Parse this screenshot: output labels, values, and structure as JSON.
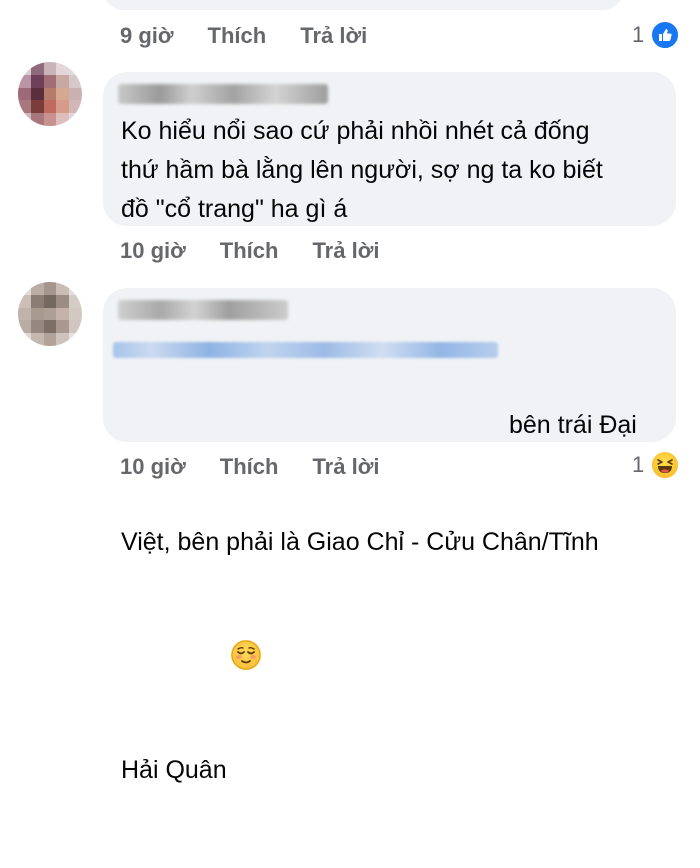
{
  "top_comment": {
    "time": "9 giờ",
    "like_label": "Thích",
    "reply_label": "Trả lời",
    "reaction_count": "1",
    "reaction_icon": "like-icon",
    "accent": "#1877f2"
  },
  "comments": [
    {
      "author": "",
      "text": "Ko hiểu nổi sao cứ phải nhồi nhét cả đống\nthứ hầm bà lằng lên người, sợ ng ta ko biết\nđồ \"cổ trang\" ha gì á",
      "time": "10 giờ",
      "like_label": "Thích",
      "reply_label": "Trả lời"
    },
    {
      "author": "",
      "text_line1_suffix": "bên trái Đại",
      "text_line2": "Việt, bên phải là Giao Chỉ - Cửu Chân/Tĩnh",
      "text_line3": "Hải Quân",
      "text_emoji": "relieved-face-emoji",
      "time": "10 giờ",
      "like_label": "Thích",
      "reply_label": "Trả lời",
      "reaction_count": "1",
      "reaction_icon": "haha-icon"
    }
  ],
  "colors": {
    "bubble_bg": "#f0f2f5",
    "meta_text": "#65676b",
    "body_text": "#050505"
  }
}
